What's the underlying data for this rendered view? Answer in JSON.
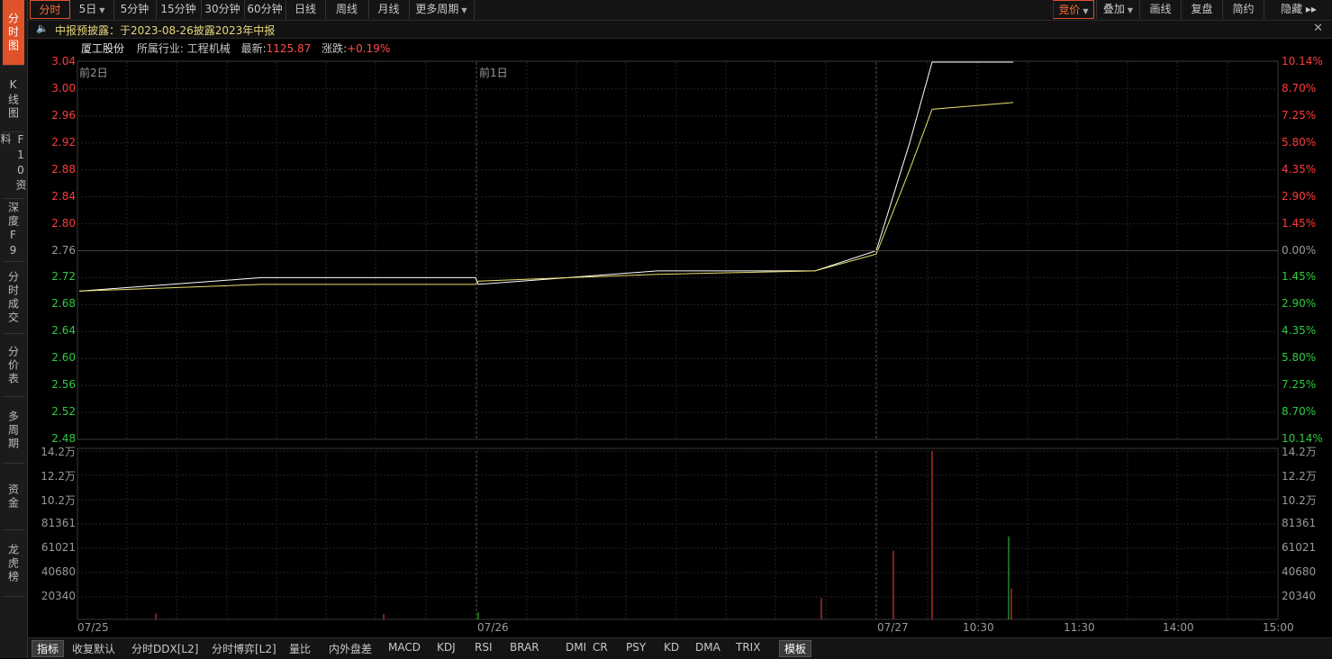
{
  "left_tabs": [
    "分时图",
    "K线图",
    "F10资料",
    "深度F9",
    "分时成交",
    "分价表",
    "多周期",
    "资金",
    "龙虎榜"
  ],
  "top_tabs": {
    "left": [
      {
        "label": "分时",
        "caret": false
      },
      {
        "label": "5日",
        "caret": true
      },
      {
        "label": "5分钟",
        "caret": false
      },
      {
        "label": "15分钟",
        "caret": false
      },
      {
        "label": "30分钟",
        "caret": false
      },
      {
        "label": "60分钟",
        "caret": false
      },
      {
        "label": "日线",
        "caret": false
      },
      {
        "label": "周线",
        "caret": false
      },
      {
        "label": "月线",
        "caret": false
      },
      {
        "label": "更多周期",
        "caret": true
      }
    ],
    "right": [
      {
        "label": "竞价",
        "caret": true
      },
      {
        "label": "叠加",
        "caret": true
      },
      {
        "label": "画线",
        "caret": false
      },
      {
        "label": "复盘",
        "caret": false
      },
      {
        "label": "简约",
        "caret": false
      },
      {
        "label": "隐藏 ▸▸",
        "caret": false
      }
    ]
  },
  "notice": {
    "text": "中报预披露：于2023-08-26披露2023年中报",
    "close": "✕"
  },
  "stock": {
    "name": "厦工股份",
    "industry_label": "所属行业:",
    "industry": "工程机械",
    "latest_label": "最新:",
    "latest": "1125.87",
    "change_label": "涨跌:",
    "change": "+0.19%"
  },
  "price_axis": {
    "left": [
      "3.04",
      "3.00",
      "2.96",
      "2.92",
      "2.88",
      "2.84",
      "2.80",
      "2.76",
      "2.72",
      "2.68",
      "2.64",
      "2.60",
      "2.56",
      "2.52",
      "2.48"
    ],
    "right": [
      "10.14%",
      "8.70%",
      "7.25%",
      "5.80%",
      "4.35%",
      "2.90%",
      "1.45%",
      "0.00%",
      "1.45%",
      "2.90%",
      "4.35%",
      "5.80%",
      "7.25%",
      "8.70%",
      "10.14%"
    ]
  },
  "day_labels": [
    "前2日",
    "前1日"
  ],
  "volume_axis": [
    "14.2万",
    "12.2万",
    "10.2万",
    "81361",
    "61021",
    "40680",
    "20340"
  ],
  "time_axis": [
    "07/25",
    "07/26",
    "07/27",
    "10:30",
    "11:30",
    "14:00",
    "15:00"
  ],
  "indicator_bar": [
    "指标",
    "收复默认",
    "分时DDX[L2]",
    "分时博弈[L2]",
    "量比",
    "内外盘差",
    "MACD",
    "KDJ",
    "RSI",
    "BRAR",
    "DMI",
    "CR",
    "PSY",
    "KD",
    "DMA",
    "TRIX",
    "模板"
  ],
  "colors": {
    "accent": "#e0522a",
    "up": "#ff3b3b",
    "down": "#2ecc40",
    "price_line": "#ffffff",
    "avg_line": "#e8e06a"
  },
  "chart_data": {
    "type": "line",
    "title": "",
    "price_range": [
      2.48,
      3.04
    ],
    "prev_close": 2.76,
    "x": [
      "07/25 09:30",
      "07/25 11:30",
      "07/25 15:00",
      "07/26 09:30",
      "07/26 11:30",
      "07/26 15:00",
      "07/27 09:30",
      "07/27 10:00",
      "07/27 10:30",
      "07/27 11:00"
    ],
    "series": [
      {
        "name": "",
        "type": "price",
        "values": [
          2.7,
          2.72,
          2.72,
          2.71,
          2.73,
          2.73,
          2.76,
          2.92,
          3.04,
          3.04
        ]
      },
      {
        "name": "",
        "type": "average",
        "values": [
          2.7,
          2.71,
          2.71,
          2.715,
          2.725,
          2.73,
          2.755,
          2.88,
          2.97,
          2.98
        ]
      }
    ],
    "volume": {
      "max": 142000,
      "spikes": [
        {
          "x": "07/25 10:40",
          "v": 5000,
          "dir": "up"
        },
        {
          "x": "07/25 14:30",
          "v": 4500,
          "dir": "up"
        },
        {
          "x": "07/26 09:30",
          "v": 6000,
          "dir": "down"
        },
        {
          "x": "07/26 14:40",
          "v": 18000,
          "dir": "up"
        },
        {
          "x": "07/27 09:45",
          "v": 58000,
          "dir": "up"
        },
        {
          "x": "07/27 10:05",
          "v": 142000,
          "dir": "up"
        },
        {
          "x": "07/27 10:55",
          "v": 70000,
          "dir": "down"
        },
        {
          "x": "07/27 11:00",
          "v": 26000,
          "dir": "up"
        }
      ]
    }
  }
}
